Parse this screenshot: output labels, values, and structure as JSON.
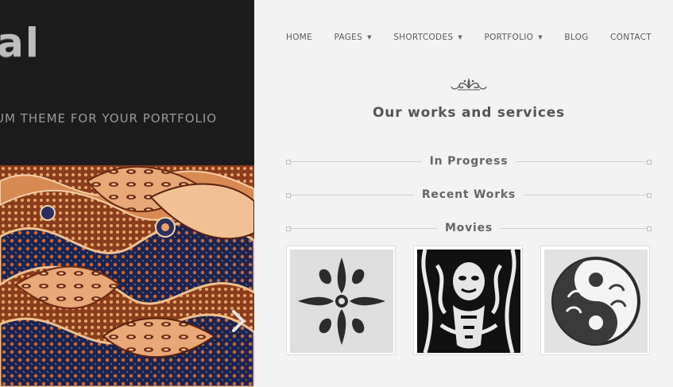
{
  "brand": {
    "logo_text": "al",
    "tagline": "UM THEME FOR YOUR PORTFOLIO"
  },
  "nav": {
    "items": [
      {
        "label": "HOME",
        "has_dropdown": false
      },
      {
        "label": "PAGES",
        "has_dropdown": true
      },
      {
        "label": "SHORTCODES",
        "has_dropdown": true
      },
      {
        "label": "PORTFOLIO",
        "has_dropdown": true
      },
      {
        "label": "BLOG",
        "has_dropdown": false
      },
      {
        "label": "CONTACT",
        "has_dropdown": false
      }
    ]
  },
  "main": {
    "title": "Our works and services",
    "sections": [
      {
        "label": "In Progress"
      },
      {
        "label": "Recent Works"
      },
      {
        "label": "Movies"
      }
    ],
    "thumbnails": [
      {
        "icon": "tribal-cross-ornament-image"
      },
      {
        "icon": "tribal-mask-pattern-image"
      },
      {
        "icon": "tribal-yin-yang-image"
      }
    ]
  },
  "slider": {
    "image": "batik-pattern-image",
    "next_icon": "chevron-right-icon"
  },
  "colors": {
    "left_background": "#1c1c1c",
    "page_background": "#f3f3f3",
    "text": "#555555",
    "batik_base": "#a14e26"
  }
}
